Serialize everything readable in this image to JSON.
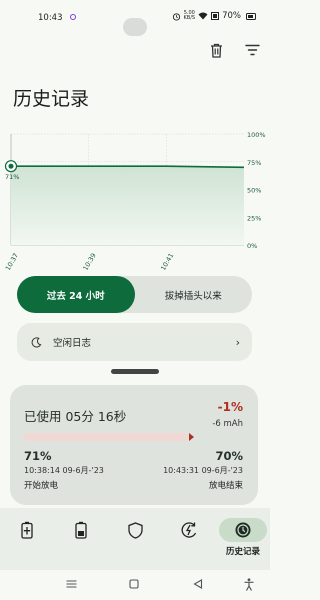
{
  "status_bar": {
    "time": "10:43",
    "net_speed_value": "5.00",
    "net_speed_unit": "KB/S",
    "battery": "70%"
  },
  "top_actions": {
    "delete_icon": "trash-icon",
    "filter_icon": "filter-icon"
  },
  "header": {
    "title": "历史记录"
  },
  "chart_data": {
    "type": "area",
    "x": [
      "10:37",
      "10:39",
      "10:41",
      "10:43"
    ],
    "y": [
      71,
      71,
      71,
      70
    ],
    "x_tick_labels": [
      "10:37",
      "10:39",
      "10:41"
    ],
    "ylim": [
      0,
      100
    ],
    "y_ticks": [
      "100%",
      "75%",
      "50%",
      "25%",
      "0%"
    ],
    "start_label": "71%",
    "series_color": "#0d6b3c",
    "fill_color": "#cfe3d4",
    "grid": true
  },
  "range_toggle": {
    "options": [
      "过去 24 小时",
      "拔掉插头以来"
    ],
    "active_index": 0
  },
  "idle_log": {
    "label": "空闲日志",
    "icon": "moon-icon"
  },
  "summary": {
    "used_label": "已使用 05分 16秒",
    "percent_change": "-1%",
    "mah_change": "-6 mAh",
    "start_pct": "71%",
    "end_pct": "70%",
    "start_time": "10:38:14 09-6月-'23",
    "end_time": "10:43:31 09-6月-'23",
    "start_label": "开始放电",
    "end_label": "放电结束",
    "accent_color": "#b03020"
  },
  "bottom_nav": {
    "items": [
      {
        "icon": "battery-charging-icon",
        "label": ""
      },
      {
        "icon": "battery-icon",
        "label": ""
      },
      {
        "icon": "shield-icon",
        "label": ""
      },
      {
        "icon": "battery-saver-icon",
        "label": ""
      },
      {
        "icon": "history-icon",
        "label": "历史记录"
      }
    ],
    "active_index": 4
  },
  "system_nav": [
    "menu-icon",
    "home-icon",
    "back-icon",
    "accessibility-icon"
  ]
}
